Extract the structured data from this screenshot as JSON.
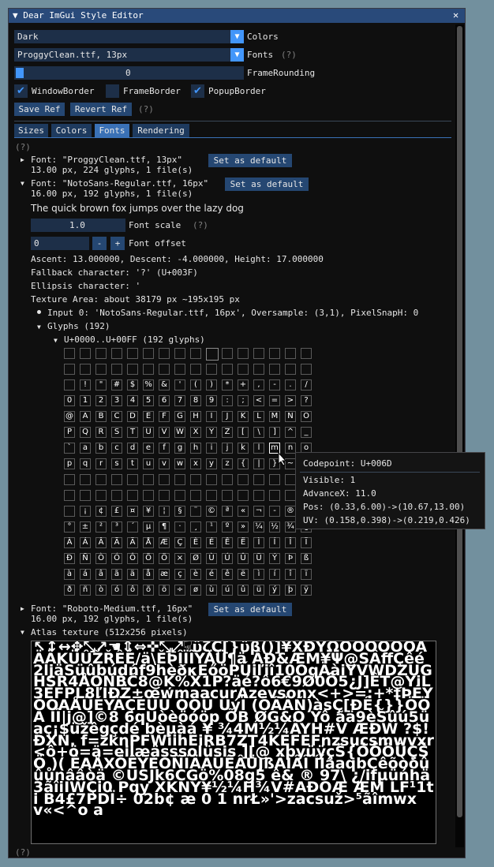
{
  "window": {
    "title": "Dear ImGui Style Editor",
    "collapse_icon": "triangle-down",
    "close_label": "✕"
  },
  "colors_combo": {
    "value": "Dark",
    "label": "Colors"
  },
  "fonts_combo": {
    "value": "ProggyClean.ttf, 13px",
    "label": "Fonts",
    "help": "(?)"
  },
  "frame_rounding": {
    "value": "0",
    "label": "FrameRounding"
  },
  "checkboxes": [
    {
      "label": "WindowBorder",
      "checked": true
    },
    {
      "label": "FrameBorder",
      "checked": false
    },
    {
      "label": "PopupBorder",
      "checked": true
    }
  ],
  "buttons": {
    "save_ref": "Save Ref",
    "revert_ref": "Revert Ref",
    "help": "(?)"
  },
  "tabs": [
    {
      "label": "Sizes",
      "active": false
    },
    {
      "label": "Colors",
      "active": false
    },
    {
      "label": "Fonts",
      "active": true
    },
    {
      "label": "Rendering",
      "active": false
    }
  ],
  "fonts_tab": {
    "help": "(?)",
    "set_default": "Set as default",
    "font1": {
      "title": "Font: \"ProggyClean.ttf, 13px\"",
      "info": "13.00 px, 224 glyphs, 1 file(s)"
    },
    "font2": {
      "title": "Font: \"NotoSans-Regular.ttf, 16px\"",
      "info": "16.00 px, 192 glyphs, 1 file(s)",
      "sample": "The quick brown fox jumps over the lazy dog",
      "font_scale_value": "1.0",
      "font_scale_label": "Font scale",
      "font_scale_help": "(?)",
      "font_offset_value": "0",
      "minus": "-",
      "plus": "+",
      "font_offset_label": "Font offset",
      "metrics": "Ascent: 13.000000, Descent: -4.000000, Height: 17.000000",
      "fallback": "Fallback character: '?' (U+003F)",
      "ellipsis": "Ellipsis character: '",
      "texture_area": "Texture Area: about 38179 px ~195x195 px",
      "input0": "Input 0: 'NotoSans-Regular.ttf, 16px', Oversample: (3,1), PixelSnapH: 0",
      "glyphs_header": "Glyphs (192)",
      "range_header": "U+0000..U+00FF (192 glyphs)"
    },
    "font3": {
      "title": "Font: \"Roboto-Medium.ttf, 16px\"",
      "info": "16.00 px, 192 glyphs, 1 file(s)"
    },
    "atlas_header": "Atlas texture (512x256 pixels)",
    "atlas_text": "↖↕↔✥⤡↗☚⇕⇔✜⤡⤢☟ΰζÇ[}ϋβ()]¥ΧÐΫΩÕÖÕÕÔÔÄÄÄΚÜÛŽŘÊÉ/ä\\ĚÞÎÏÎÝÄÜ¶ä ÂÐ&ÆΜ¥Ψ@SÂffÇêé2ĺjäSüûbúdńf9hèðκEőöPÚiľiî10ÖqÄàiÝVWDZUGHSR4ÅONBČ8@Ķ%X1P?äé?ô6€9Ø0Ö5¿J]ÊT@YiL 3EFPL8ľIÐŻ±œwmaacurAzevsonx<+>=:+*‡ÞÉYÖOAÅÜÉYÄÇÉÜÜ ÒÖÜ ÚýÏ (ÖÂÄÑ)àsÇ[ÐÊ{}}ÖÖÄ ÏÎ|j@]©8 6qÜòèöóöp ÕB ØG&Ò Ÿô ãä9èŠûú5üaç¡$üžêgçdé bèµàá ¥ ¾4M½¼ÄYH#V ÆÐW ?$!ÐXN. f=zknPFWiihEiRB7ZT4KEFEFnzsucsmwvxr<ô+ö=ä=eilæässsolüsis ][@ xþyüÿçŠ{ÖÖÖÛÇŠ Ö )( ÊAÅXÔÊÝÈÖÑÏÄÁÜÊÂÜJßÄÏÂÎ ÍÍâaqbÇêõòöûûůnââòä ©USJk6CGö%08g5 ê& ® 97\\ ¿/ifµüńhä 3ãîiIWÇi0 Pqy XKNÝ¥½¼H¾V#AÐOÆ ÆM LF¹1ti B4£7PDÏ÷ 02b¢ æ 0 1 nrŁ»'>zacsuž>⁵ãîmwxv«<^o a",
    "glyph_rows": [
      [
        " ",
        " ",
        " ",
        " ",
        " ",
        " ",
        " ",
        " ",
        " ",
        " ",
        " ",
        " ",
        " ",
        " ",
        " ",
        " "
      ],
      [
        " ",
        " ",
        " ",
        " ",
        " ",
        " ",
        " ",
        " ",
        " ",
        " ",
        " ",
        " ",
        " ",
        " ",
        " ",
        " "
      ],
      [
        " ",
        "!",
        "\"",
        "#",
        "$",
        "%",
        "&",
        "'",
        "(",
        ")",
        "*",
        "+",
        ",",
        "-",
        ".",
        "/"
      ],
      [
        "0",
        "1",
        "2",
        "3",
        "4",
        "5",
        "6",
        "7",
        "8",
        "9",
        ":",
        ";",
        "<",
        "=",
        ">",
        "?"
      ],
      [
        "@",
        "A",
        "B",
        "C",
        "D",
        "E",
        "F",
        "G",
        "H",
        "I",
        "J",
        "K",
        "L",
        "M",
        "N",
        "O"
      ],
      [
        "P",
        "Q",
        "R",
        "S",
        "T",
        "U",
        "V",
        "W",
        "X",
        "Y",
        "Z",
        "[",
        "\\",
        "]",
        "^",
        "_"
      ],
      [
        "`",
        "a",
        "b",
        "c",
        "d",
        "e",
        "f",
        "g",
        "h",
        "i",
        "j",
        "k",
        "l",
        "m",
        "n",
        "o"
      ],
      [
        "p",
        "q",
        "r",
        "s",
        "t",
        "u",
        "v",
        "w",
        "x",
        "y",
        "z",
        "{",
        "|",
        "}",
        "~",
        " "
      ],
      [
        " ",
        " ",
        " ",
        " ",
        " ",
        " ",
        " ",
        " ",
        " ",
        " ",
        " ",
        " ",
        " ",
        " ",
        " ",
        " "
      ],
      [
        " ",
        " ",
        " ",
        " ",
        " ",
        " ",
        " ",
        " ",
        " ",
        " ",
        " ",
        " ",
        " ",
        " ",
        " ",
        " "
      ],
      [
        " ",
        "¡",
        "¢",
        "£",
        "¤",
        "¥",
        "¦",
        "§",
        "¨",
        "©",
        "ª",
        "«",
        "¬",
        "-",
        "®",
        "¯"
      ],
      [
        "°",
        "±",
        "²",
        "³",
        "´",
        "µ",
        "¶",
        "·",
        "¸",
        "¹",
        "º",
        "»",
        "¼",
        "½",
        "¾",
        "¿"
      ],
      [
        "À",
        "Á",
        "Â",
        "Ã",
        "Ä",
        "Å",
        "Æ",
        "Ç",
        "È",
        "É",
        "Ê",
        "Ë",
        "Ì",
        "Í",
        "Î",
        "Ï"
      ],
      [
        "Ð",
        "Ñ",
        "Ò",
        "Ó",
        "Ô",
        "Õ",
        "Ö",
        "×",
        "Ø",
        "Ù",
        "Ú",
        "Û",
        "Ü",
        "Ý",
        "Þ",
        "ß"
      ],
      [
        "à",
        "á",
        "â",
        "ã",
        "ä",
        "å",
        "æ",
        "ç",
        "è",
        "é",
        "ê",
        "ë",
        "ì",
        "í",
        "î",
        "ï"
      ],
      [
        "ð",
        "ñ",
        "ò",
        "ó",
        "ô",
        "õ",
        "ö",
        "÷",
        "ø",
        "ù",
        "ú",
        "û",
        "ü",
        "ý",
        "þ",
        "ÿ"
      ]
    ],
    "tooltip": {
      "codepoint": "Codepoint: U+006D",
      "visible": "Visible: 1",
      "advance": "AdvanceX: 11.0",
      "pos": "Pos: (0.33,6.00)->(10.67,13.00)",
      "uv": "UV: (0.158,0.398)->(0.219,0.426)"
    }
  },
  "footer_help": "(?)",
  "colors": {
    "accent": "#4296fa",
    "title_bar": "#294a7a",
    "frame_bg": "#1d2f48",
    "button": "#254772",
    "window_bg": "#0f0f0f",
    "desktop": "#72909e"
  },
  "icons": {
    "collapse": "triangle-down-icon",
    "close": "close-icon",
    "combo_arrow": "chevron-down-icon",
    "check": "checkmark-icon",
    "cursor": "mouse-cursor-icon"
  }
}
